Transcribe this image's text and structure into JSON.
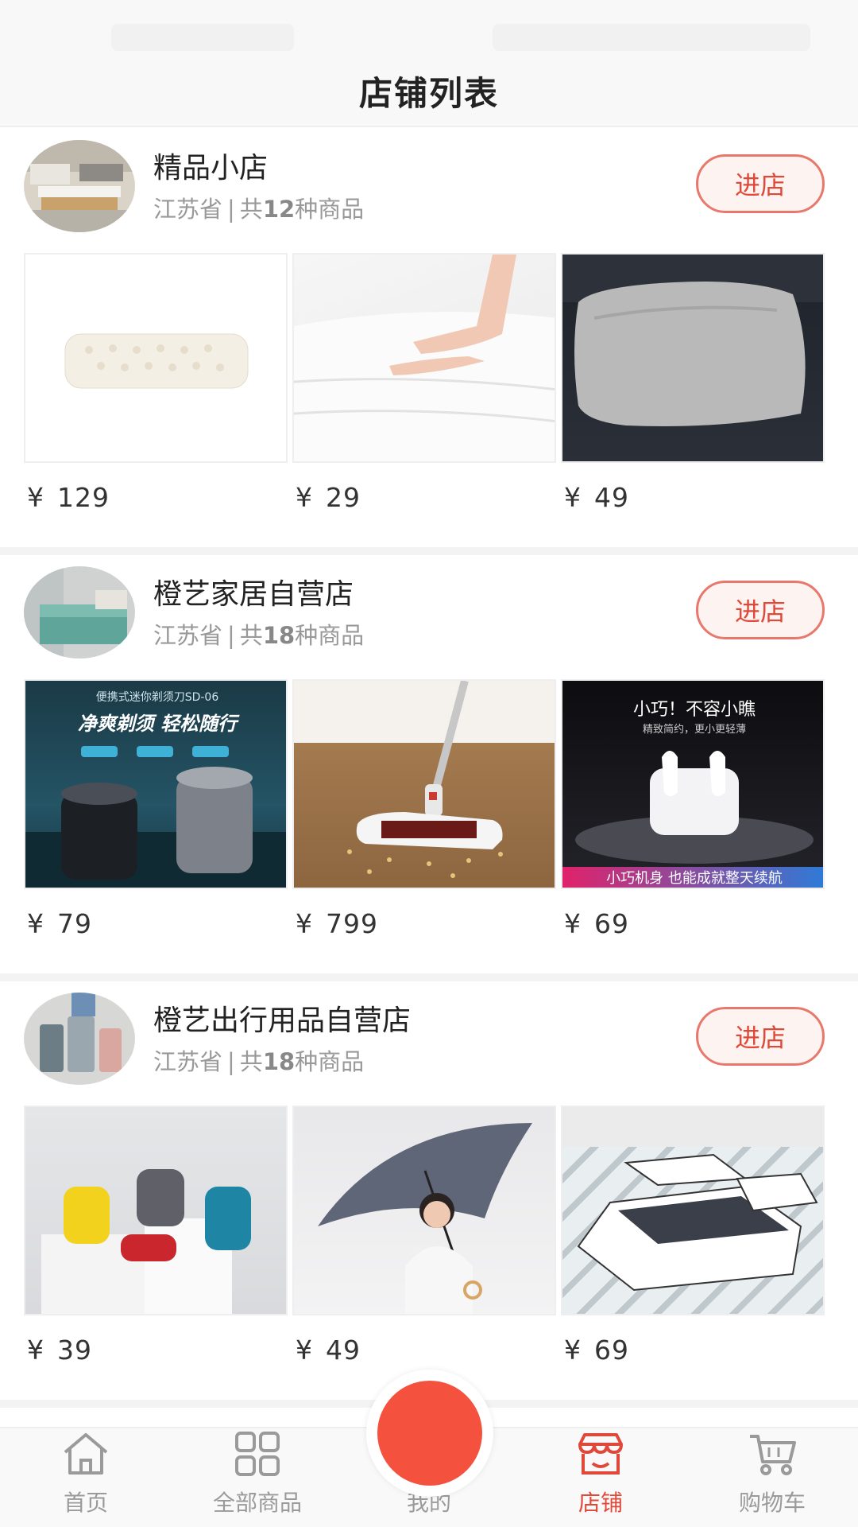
{
  "header": {
    "title": "店铺列表"
  },
  "shops": [
    {
      "name": "精品小店",
      "province": "江苏省",
      "separator": "|",
      "count_prefix": "共",
      "count": "12",
      "count_suffix": "种商品",
      "enter_label": "进店",
      "products": [
        {
          "price": "129",
          "currency": "¥"
        },
        {
          "price": "29",
          "currency": "¥"
        },
        {
          "price": "49",
          "currency": "¥"
        }
      ]
    },
    {
      "name": "橙艺家居自营店",
      "province": "江苏省",
      "separator": "|",
      "count_prefix": "共",
      "count": "18",
      "count_suffix": "种商品",
      "enter_label": "进店",
      "products": [
        {
          "price": "79",
          "currency": "¥",
          "banner_top": "便携式迷你剃须刀SD-06",
          "banner_main": "净爽剃须  轻松随行"
        },
        {
          "price": "799",
          "currency": "¥"
        },
        {
          "price": "69",
          "currency": "¥",
          "banner_top": "小巧！不容小瞧",
          "banner_sub": "精致简约，更小更轻薄",
          "banner_bottom": "小巧机身 也能成就整天续航"
        }
      ]
    },
    {
      "name": "橙艺出行用品自营店",
      "province": "江苏省",
      "separator": "|",
      "count_prefix": "共",
      "count": "18",
      "count_suffix": "种商品",
      "enter_label": "进店",
      "products": [
        {
          "price": "39",
          "currency": "¥"
        },
        {
          "price": "49",
          "currency": "¥"
        },
        {
          "price": "69",
          "currency": "¥"
        }
      ]
    }
  ],
  "tabbar": {
    "items": [
      {
        "label": "首页",
        "icon": "home-icon"
      },
      {
        "label": "全部商品",
        "icon": "grid-icon"
      },
      {
        "label": "我的",
        "icon": "profile-center-button"
      },
      {
        "label": "店铺",
        "icon": "shop-icon",
        "active": true
      },
      {
        "label": "购物车",
        "icon": "cart-icon"
      }
    ]
  },
  "colors": {
    "accent": "#e0483a",
    "center_button": "#f4523e",
    "inactive": "#9a9a9a"
  }
}
